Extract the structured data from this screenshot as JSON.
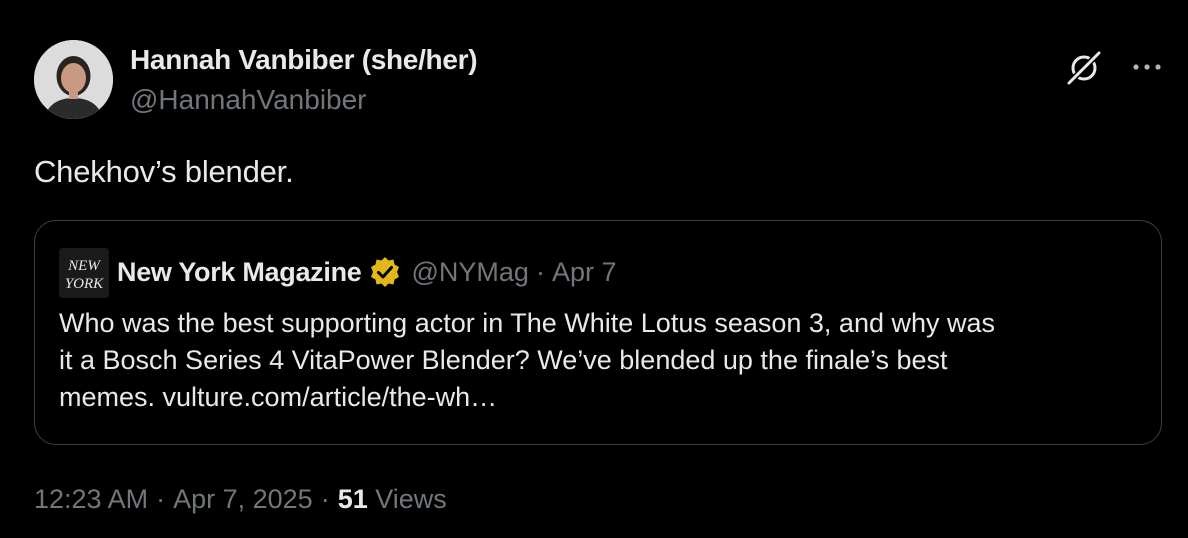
{
  "author": {
    "display_name": "Hannah Vanbiber (she/her)",
    "handle": "@HannahVanbiber"
  },
  "tweet": {
    "text": "Chekhov’s blender."
  },
  "quoted": {
    "avatar_text_1": "NEW",
    "avatar_text_2": "YORK",
    "name": "New York Magazine",
    "handle": "@NYMag",
    "separator": "·",
    "date": "Apr 7",
    "body_lines": [
      "Who was the best supporting actor in The White Lotus season 3, and why was",
      "it a Bosch Series 4 VitaPower Blender? We’ve blended up the finale’s best",
      "memes. vulture.com/article/the-wh…"
    ]
  },
  "meta": {
    "time": "12:23 AM",
    "separator": "·",
    "date": "Apr 7, 2025",
    "views_count": "51",
    "views_label": "Views"
  },
  "icons": {
    "grok": "grok-icon",
    "more": "more-icon",
    "verified": "verified-badge-icon"
  },
  "colors": {
    "background": "#000000",
    "primary_text": "#e7e9ea",
    "secondary_text": "#71767b",
    "border": "#3a3f44",
    "verified_gold": "#e2b719"
  }
}
